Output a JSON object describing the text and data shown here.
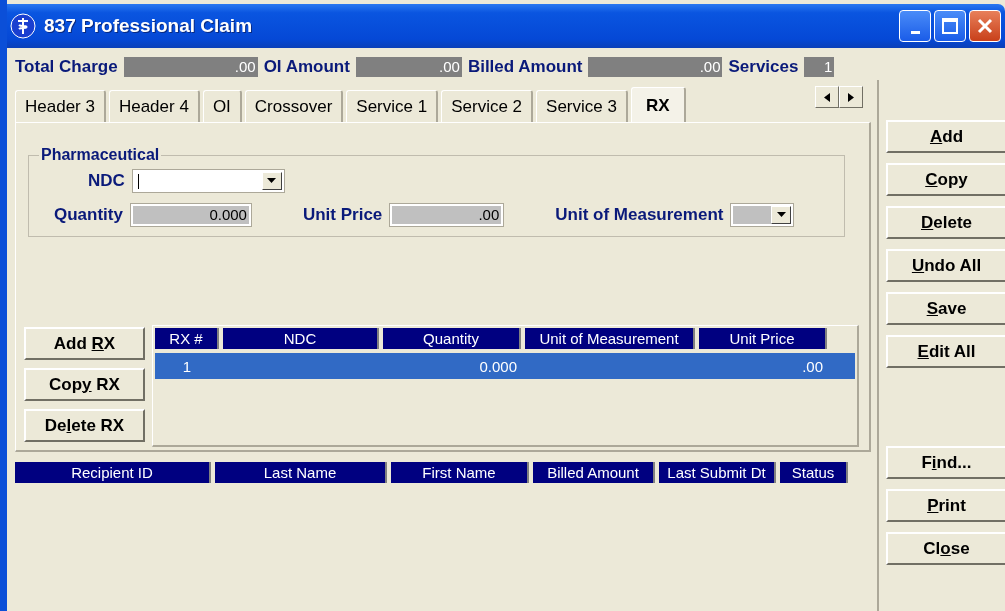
{
  "window": {
    "title": "837 Professional Claim"
  },
  "summary": [
    {
      "label": "Total Charge",
      "value": ".00"
    },
    {
      "label": "OI Amount",
      "value": ".00"
    },
    {
      "label": "Billed Amount",
      "value": ".00"
    },
    {
      "label": "Services",
      "value": "1"
    }
  ],
  "tabs": [
    {
      "label": "Header 3",
      "selected": false
    },
    {
      "label": "Header 4",
      "selected": false
    },
    {
      "label": "OI",
      "selected": false
    },
    {
      "label": "Crossover",
      "selected": false
    },
    {
      "label": "Service 1",
      "selected": false
    },
    {
      "label": "Service 2",
      "selected": false
    },
    {
      "label": "Service 3",
      "selected": false
    },
    {
      "label": "RX",
      "selected": true
    }
  ],
  "pharmaceutical": {
    "title": "Pharmaceutical",
    "ndc": {
      "label": "NDC"
    },
    "quantity": {
      "label": "Quantity",
      "value": "0.000"
    },
    "unit_price": {
      "label": "Unit Price",
      "value": ".00"
    },
    "unit_of_measurement": {
      "label": "Unit of Measurement"
    }
  },
  "rx_buttons": [
    {
      "before": "Add ",
      "key": "R",
      "after": "X"
    },
    {
      "before": "Cop",
      "key": "y",
      "after": " RX"
    },
    {
      "before": "De",
      "key": "l",
      "after": "ete RX"
    }
  ],
  "rx_table": {
    "columns": [
      "RX #",
      "NDC",
      "Quantity",
      "Unit of Measurement",
      "Unit Price"
    ],
    "rows": [
      {
        "cells": [
          "1",
          null,
          "0.000",
          null,
          ".00"
        ],
        "selected": true
      }
    ]
  },
  "claims_table": {
    "columns": [
      "Recipient ID",
      "Last Name",
      "First Name",
      "Billed Amount",
      "Last Submit Dt",
      "Status"
    ]
  },
  "side_buttons_top": [
    {
      "key": "A",
      "after": "dd"
    },
    {
      "key": "C",
      "after": "opy"
    },
    {
      "key": "D",
      "after": "elete"
    },
    {
      "key": "U",
      "after": "ndo All"
    },
    {
      "key": "S",
      "after": "ave"
    },
    {
      "key": "E",
      "after": "dit All"
    }
  ],
  "side_buttons_bottom": [
    {
      "before": "F",
      "key": "i",
      "after": "nd..."
    },
    {
      "key": "P",
      "after": "rint"
    },
    {
      "before": "Cl",
      "key": "o",
      "after": "se"
    }
  ]
}
